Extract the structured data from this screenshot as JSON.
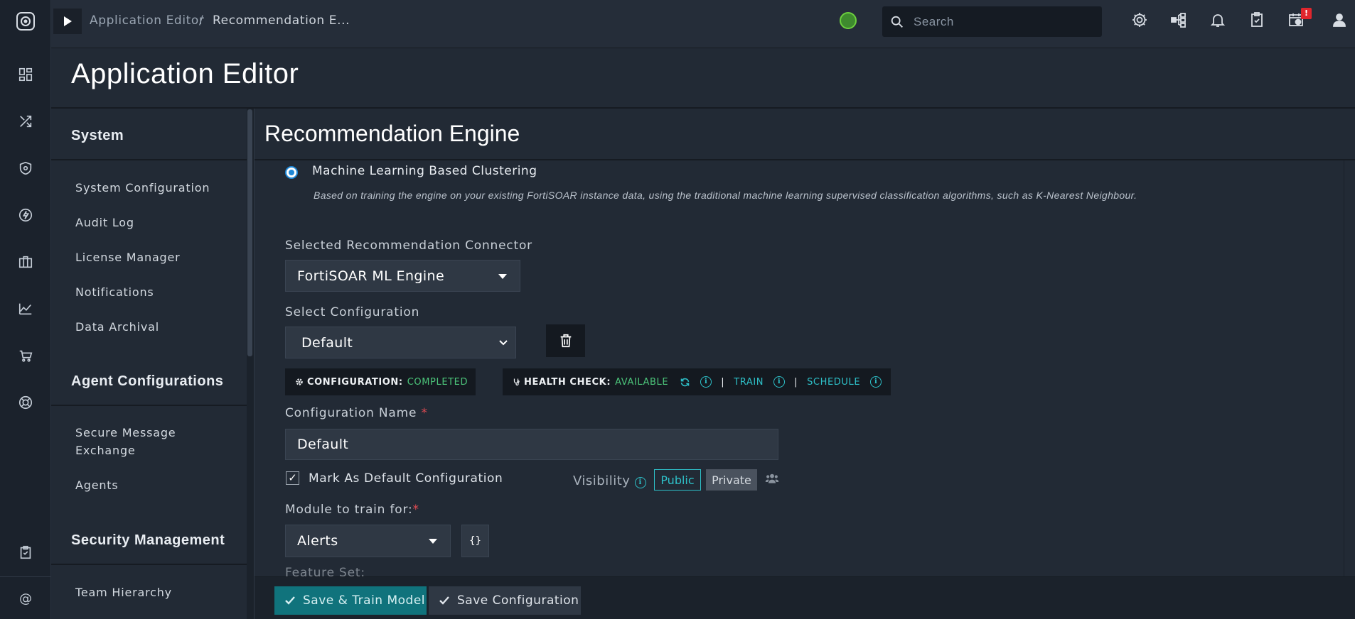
{
  "topbar": {
    "breadcrumb_parent": "Application Editor",
    "breadcrumb_sep": "/",
    "breadcrumb_current": "Recommendation E...",
    "search_placeholder": "Search",
    "notification_badge": "!"
  },
  "page": {
    "title": "Application Editor"
  },
  "subnav": {
    "sections": [
      {
        "title": "System",
        "items": [
          "System Configuration",
          "Audit Log",
          "License Manager",
          "Notifications",
          "Data Archival"
        ]
      },
      {
        "title": "Agent Configurations",
        "items": [
          "Secure Message Exchange",
          "Agents"
        ]
      },
      {
        "title": "Security Management",
        "items": [
          "Team Hierarchy"
        ]
      }
    ]
  },
  "content": {
    "title": "Recommendation Engine",
    "radio_label": "Machine Learning Based Clustering",
    "radio_selected": true,
    "radio_description": "Based on training the engine on your existing FortiSOAR instance data, using the traditional machine learning supervised classification algorithms, such as K-Nearest Neighbour.",
    "connector_label": "Selected Recommendation Connector",
    "connector_value": "FortiSOAR ML Engine",
    "config_select_label": "Select Configuration",
    "config_select_value": "Default",
    "status": {
      "config_label": "CONFIGURATION:",
      "config_value": "COMPLETED",
      "health_label": "HEALTH CHECK:",
      "health_value": "AVAILABLE",
      "separator": "|",
      "train": "TRAIN",
      "schedule": "SCHEDULE"
    },
    "config_name_label": "Configuration Name",
    "required_mark": "*",
    "config_name_value": "Default",
    "default_checkbox_label": "Mark As Default Configuration",
    "default_checked": true,
    "visibility_label": "Visibility",
    "visibility_public": "Public",
    "visibility_private": "Private",
    "module_label": "Module to train for:",
    "module_value": "Alerts",
    "module_json_btn": "{}",
    "feature_set_label": "Feature Set:"
  },
  "footer": {
    "save_train_label": "Save & Train Model",
    "save_config_label": "Save Configuration"
  },
  "colors": {
    "accent_teal": "#2ec0c8",
    "status_green": "#4cc47a",
    "primary_button": "#10737c",
    "radio_blue": "#1e87d6",
    "badge_red": "#e0262d"
  },
  "icons": [
    "logo-icon",
    "dashboard-icon",
    "shuffle-icon",
    "shield-icon",
    "bolt-icon",
    "briefcase-icon",
    "chart-icon",
    "cart-icon",
    "lifebuoy-icon",
    "clipboard-icon",
    "at-icon",
    "play-icon",
    "status-icon",
    "search-icon",
    "gear-icon",
    "hierarchy-icon",
    "bell-icon",
    "checklist-icon",
    "calendar-gear-icon",
    "user-icon",
    "trash-icon",
    "cog-icon",
    "stethoscope-icon",
    "refresh-icon",
    "info-icon",
    "team-icon",
    "check-icon"
  ]
}
